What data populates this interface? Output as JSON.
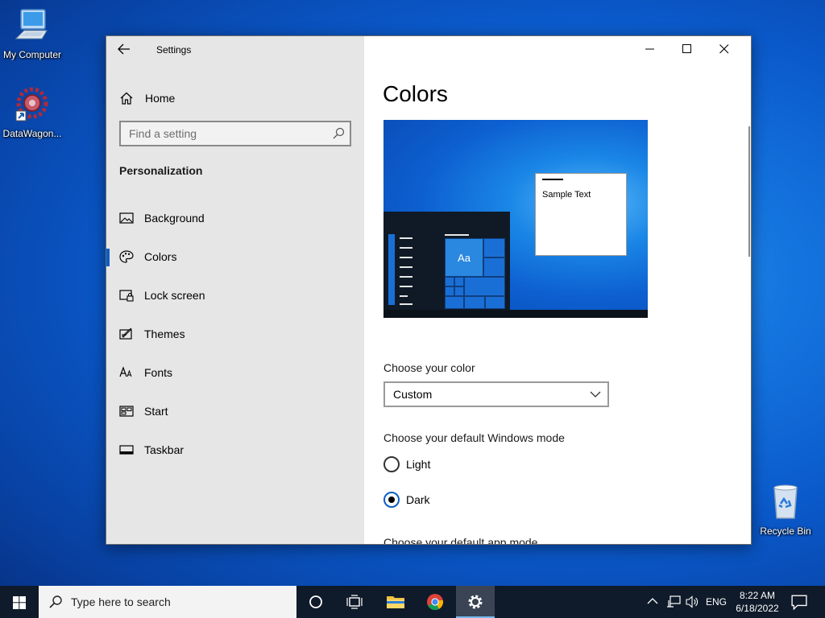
{
  "desktop": {
    "icons": [
      {
        "label": "My Computer"
      },
      {
        "label": "DataWagon..."
      },
      {
        "label": "Recycle Bin"
      }
    ]
  },
  "window": {
    "title": "Settings",
    "sidebar": {
      "home_label": "Home",
      "search_placeholder": "Find a setting",
      "section_title": "Personalization",
      "items": [
        {
          "label": "Background",
          "icon": "picture-icon"
        },
        {
          "label": "Colors",
          "icon": "palette-icon",
          "active": true
        },
        {
          "label": "Lock screen",
          "icon": "lock-screen-icon"
        },
        {
          "label": "Themes",
          "icon": "themes-icon"
        },
        {
          "label": "Fonts",
          "icon": "fonts-icon"
        },
        {
          "label": "Start",
          "icon": "start-icon"
        },
        {
          "label": "Taskbar",
          "icon": "taskbar-icon"
        }
      ]
    },
    "content": {
      "title": "Colors",
      "preview": {
        "sample_text": "Sample Text",
        "tile_text": "Aa"
      },
      "choose_color_label": "Choose your color",
      "choose_color_value": "Custom",
      "windows_mode_label": "Choose your default Windows mode",
      "windows_mode_options": [
        {
          "label": "Light",
          "checked": false
        },
        {
          "label": "Dark",
          "checked": true
        }
      ],
      "app_mode_label": "Choose your default app mode"
    },
    "accent_color": "#0b5fc4"
  },
  "taskbar": {
    "search_text": "Type here to search",
    "language": "ENG",
    "time": "8:22 AM",
    "date": "6/18/2022"
  }
}
